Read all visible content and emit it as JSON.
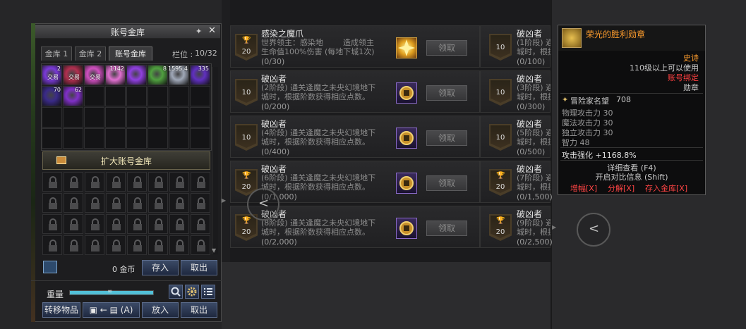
{
  "vault": {
    "title": "账号金库",
    "tabs": [
      "金库 1",
      "金库 2",
      "账号金库"
    ],
    "slots_label": "栏位 :",
    "slots_value": "10/32",
    "items": [
      {
        "icon": "purple-orb-item",
        "count": "2",
        "tag": "交易",
        "color": "#7a3ad8"
      },
      {
        "icon": "scroll-item",
        "count": "",
        "tag": "交易",
        "color": "#b03050"
      },
      {
        "icon": "pink-gem-item",
        "count": "",
        "tag": "交易",
        "color": "#d050c0"
      },
      {
        "icon": "pink-crystal-item",
        "count": "1142",
        "tag": "",
        "color": "#e070d0"
      },
      {
        "icon": "violet-shard-item",
        "count": "",
        "tag": "",
        "color": "#9040e0"
      },
      {
        "icon": "green-cube-item",
        "count": "8",
        "tag": "",
        "color": "#50a040"
      },
      {
        "icon": "silver-stone-item",
        "count": "1595.4",
        "tag": "",
        "color": "#a0a8b8"
      },
      {
        "icon": "violet-orb-item",
        "count": "335",
        "tag": "",
        "color": "#6030c0"
      },
      {
        "icon": "dark-orb-item",
        "count": "70",
        "tag": "",
        "color": "#3a2a88"
      },
      {
        "icon": "purple-swirl-item",
        "count": "62",
        "tag": "",
        "color": "#8030c8"
      }
    ],
    "expand_label": "扩大账号金库",
    "gold_amount": "0 金币",
    "deposit_label": "存入",
    "withdraw_label": "取出",
    "weight_label": "重量",
    "weight_value": "∞",
    "transfer_label": "转移物品",
    "auto_label": "(A)",
    "put_label": "放入",
    "take_label": "取出"
  },
  "missions": [
    {
      "badge": "20",
      "trophy": true,
      "title": "感染之魔爪",
      "desc": "世界领主：感染地        造成领主\n生命值100%伤害 (每地下城1次)",
      "progress": "(0/30)",
      "reward": "gold-star-reward",
      "claim": "领取"
    },
    {
      "badge": "10",
      "trophy": false,
      "title": "破凶者",
      "desc": "(2阶段) 通关逢魔之未央幻境地下\n城时，根据阶数获得相应点数。",
      "progress": "(0/200)",
      "reward": "seal-reward",
      "claim": "领取"
    },
    {
      "badge": "10",
      "trophy": false,
      "title": "破凶者",
      "desc": "(4阶段) 通关逢魔之未央幻境地下\n城时，根据阶数获得相应点数。",
      "progress": "(0/400)",
      "reward": "seal-reward",
      "claim": "领取"
    },
    {
      "badge": "20",
      "trophy": true,
      "title": "破凶者",
      "desc": "(6阶段) 通关逢魔之未央幻境地下\n城时，根据阶数获得相应点数。",
      "progress": "(0/1,000)",
      "reward": "seal-reward",
      "claim": "领取"
    },
    {
      "badge": "20",
      "trophy": true,
      "title": "破凶者",
      "desc": "(8阶段) 通关逢魔之未央幻境地下\n城时，根据阶数获得相应点数。",
      "progress": "(0/2,000)",
      "reward": "seal-reward",
      "claim": "领取"
    }
  ],
  "missions_right": [
    {
      "badge": "10",
      "trophy": false,
      "title": "破凶者",
      "desc": "(1阶段) 通\n城时，根据",
      "progress": "(0/100)"
    },
    {
      "badge": "10",
      "trophy": false,
      "title": "破凶者",
      "desc": "(3阶段) 通\n城时，根据",
      "progress": "(0/300)"
    },
    {
      "badge": "10",
      "trophy": false,
      "title": "破凶者",
      "desc": "(5阶段) 通\n城时，根据",
      "progress": "(0/500)"
    },
    {
      "badge": "20",
      "trophy": true,
      "title": "破凶者",
      "desc": "(7阶段) 通\n城时，根据",
      "progress": "(0/1,500)"
    },
    {
      "badge": "20",
      "trophy": true,
      "title": "破凶者",
      "desc": "(9阶段) 通\n城时，根据",
      "progress": "(0/2,500)"
    }
  ],
  "tooltip": {
    "name": "荣光的胜利勋章",
    "rarity": "史诗",
    "level_req": "110级以上可以使用",
    "binding": "账号绑定",
    "type": "勋章",
    "reputation_label": "冒险家名望",
    "reputation_value": "708",
    "stats": [
      "物理攻击力 30",
      "魔法攻击力 30",
      "独立攻击力 30",
      "智力 48"
    ],
    "attack_boost": "攻击强化 +1168.8%",
    "detail": "详细查看 (F4)",
    "compare": "开启对比信息 (Shift)",
    "action_amplify": "增幅[X]",
    "action_disassemble": "分解[X]",
    "action_store": "存入金库[X]",
    "colors": {
      "name": "#ff9d2d",
      "epic": "#ff9d2d",
      "bind": "#ff4040",
      "action": "#ff4444"
    }
  }
}
